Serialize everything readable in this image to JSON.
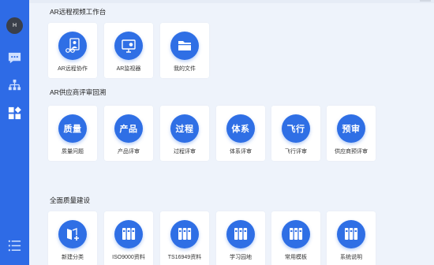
{
  "sidebar": {
    "avatar_letter": "H",
    "icons": [
      "chat-icon",
      "org-chart-icon",
      "apps-icon",
      "menu-list-icon"
    ]
  },
  "sections": [
    {
      "title": "AR远程视频工作台",
      "items": [
        {
          "label": "AR远程协作",
          "icon": "ar-collab-icon"
        },
        {
          "label": "AR监视器",
          "icon": "ar-monitor-icon"
        },
        {
          "label": "我的文件",
          "icon": "folder-icon"
        }
      ]
    },
    {
      "title": "AR供应商评审回溯",
      "items": [
        {
          "label": "质量问题",
          "circle_text": "质量"
        },
        {
          "label": "产品评审",
          "circle_text": "产品"
        },
        {
          "label": "过程评审",
          "circle_text": "过程"
        },
        {
          "label": "体系评审",
          "circle_text": "体系"
        },
        {
          "label": "飞行评审",
          "circle_text": "飞行"
        },
        {
          "label": "供应商预评审",
          "circle_text": "预审"
        }
      ]
    },
    {
      "title": "全面质量建设",
      "items": [
        {
          "label": "新建分类",
          "icon": "book-add-icon"
        },
        {
          "label": "ISO9000资料",
          "icon": "binders-icon"
        },
        {
          "label": "TS16949资料",
          "icon": "binders-icon"
        },
        {
          "label": "学习园地",
          "icon": "binders-icon"
        },
        {
          "label": "常用模板",
          "icon": "binders-icon"
        },
        {
          "label": "系统说明",
          "icon": "binders-icon"
        }
      ]
    }
  ],
  "colors": {
    "sidebar": "#2e6be6",
    "accent": "#2f6fe5",
    "background": "#eef3fb"
  }
}
